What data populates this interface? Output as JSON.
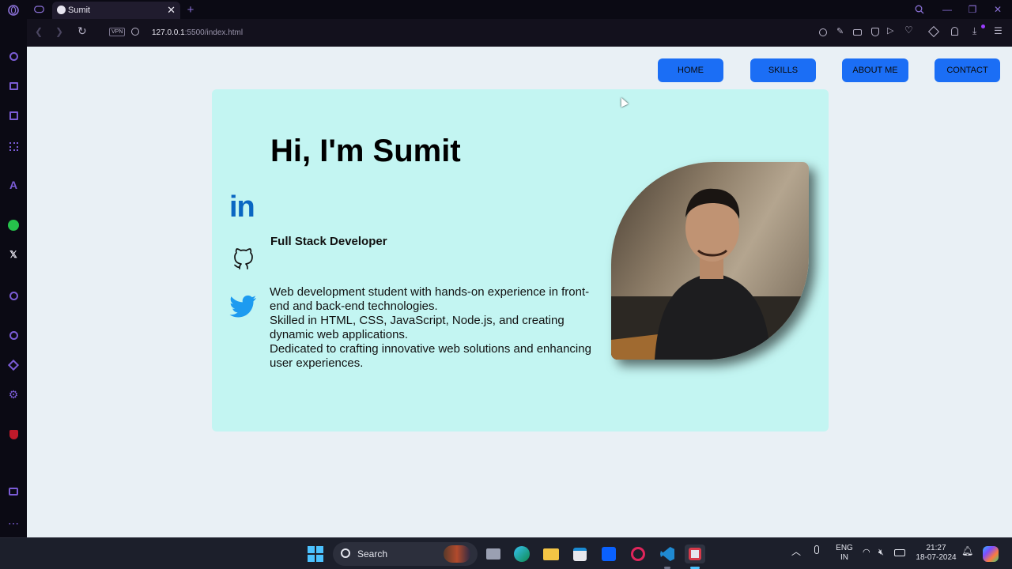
{
  "browser": {
    "tab_title": "Sumit",
    "vpn_label": "VPN",
    "url_host": "127.0.0.1",
    "url_rest": ":5500/index.html",
    "new_tab": "+"
  },
  "nav": {
    "home": "HOME",
    "skills": "SKILLS",
    "about": "ABOUT ME",
    "contact": "CONTACT"
  },
  "hero": {
    "heading": "Hi, I'm Sumit",
    "role": "Full Stack Developer",
    "bio_1": "Web development student with hands-on experience in front-end and back-end technologies.",
    "bio_2": "Skilled in HTML, CSS, JavaScript, Node.js, and creating dynamic web applications.",
    "bio_3": "Dedicated to crafting innovative web solutions and enhancing user experiences."
  },
  "social": {
    "linkedin": "in"
  },
  "taskbar": {
    "search_label": "Search",
    "lang_1": "ENG",
    "lang_2": "IN",
    "time": "21:27",
    "date": "18-07-2024"
  },
  "colors": {
    "accent": "#1b6ef5",
    "card_bg": "#c3f5f2",
    "page_bg": "#e9f0f5",
    "browser_accent": "#8a70d6"
  }
}
